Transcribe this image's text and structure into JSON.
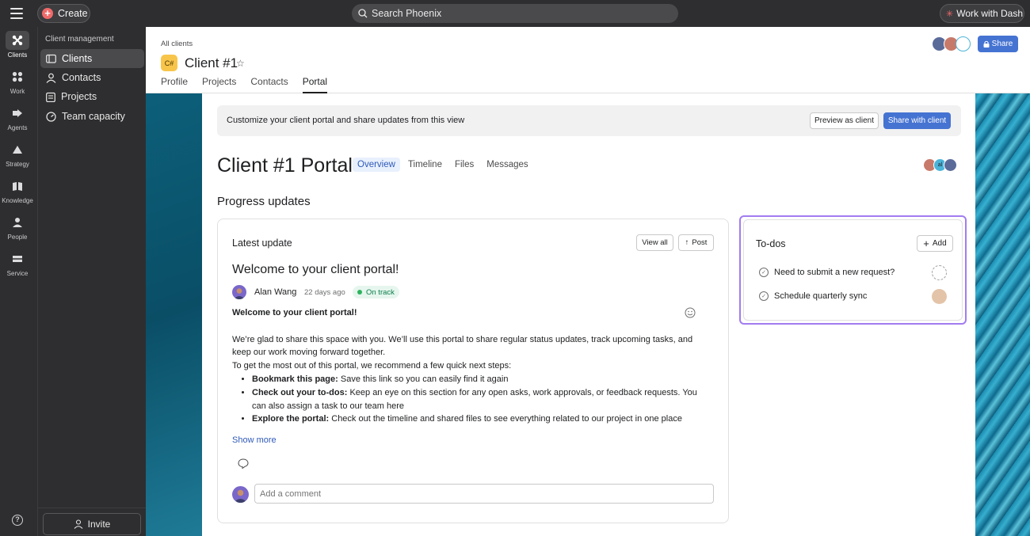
{
  "topbar": {
    "create_label": "Create",
    "search_placeholder": "Search Phoenix",
    "dash_label": "Work with Dash"
  },
  "rail": {
    "items": [
      {
        "label": "Clients",
        "icon": "clients-icon"
      },
      {
        "label": "Work",
        "icon": "work-icon"
      },
      {
        "label": "Agents",
        "icon": "agents-icon"
      },
      {
        "label": "Strategy",
        "icon": "strategy-icon"
      },
      {
        "label": "Knowledge",
        "icon": "knowledge-icon"
      },
      {
        "label": "People",
        "icon": "people-icon"
      },
      {
        "label": "Service",
        "icon": "service-icon"
      }
    ],
    "help": "?"
  },
  "sidebar": {
    "title": "Client management",
    "items": [
      {
        "label": "Clients"
      },
      {
        "label": "Contacts"
      },
      {
        "label": "Projects"
      },
      {
        "label": "Team capacity"
      }
    ],
    "invite_label": "Invite"
  },
  "header": {
    "breadcrumb": "All clients",
    "project_icon": "C#",
    "title": "Client #1",
    "tabs": [
      "Profile",
      "Projects",
      "Contacts",
      "Portal"
    ],
    "active_tab": "Portal",
    "share_label": "Share"
  },
  "portal": {
    "banner_text": "Customize your client portal and share updates from this view",
    "preview_label": "Preview as client",
    "share_client_label": "Share with client",
    "title": "Client #1 Portal",
    "tabs": [
      "Overview",
      "Timeline",
      "Files",
      "Messages"
    ],
    "active_tab": "Overview",
    "avatar_initials": "al",
    "section_title": "Progress updates"
  },
  "update": {
    "card_title": "Latest update",
    "view_all_label": "View all",
    "post_label": "Post",
    "title": "Welcome to your client portal!",
    "author": "Alan Wang",
    "time": "22 days ago",
    "status": "On track",
    "body_heading": "Welcome to your client portal!",
    "para1": "We’re glad to share this space with you. We’ll use this portal to share regular status updates, track upcoming tasks, and keep our work moving forward together.",
    "para2": "To get the most out of this portal, we recommend a few quick next steps:",
    "bullets": [
      {
        "bold": "Bookmark this page:",
        "text": " Save this link so you can easily find it again"
      },
      {
        "bold": "Check out your to-dos:",
        "text": " Keep an eye on this section for any open asks, work approvals, or feedback requests. You can also assign a task to our team here"
      },
      {
        "bold": "Explore the portal:",
        "text": " Check out the timeline and shared files to see everything related to our project in one place"
      }
    ],
    "show_more": "Show more",
    "comment_placeholder": "Add a comment"
  },
  "todos": {
    "title": "To-dos",
    "add_label": "Add",
    "items": [
      {
        "text": "Need to submit a new request?",
        "assignee": "empty"
      },
      {
        "text": "Schedule quarterly sync",
        "assignee": "person"
      }
    ]
  },
  "colors": {
    "accent_blue": "#4573d2",
    "status_green": "#2db35f",
    "create_red": "#f06a6a",
    "todo_highlight": "#a27cf0"
  }
}
